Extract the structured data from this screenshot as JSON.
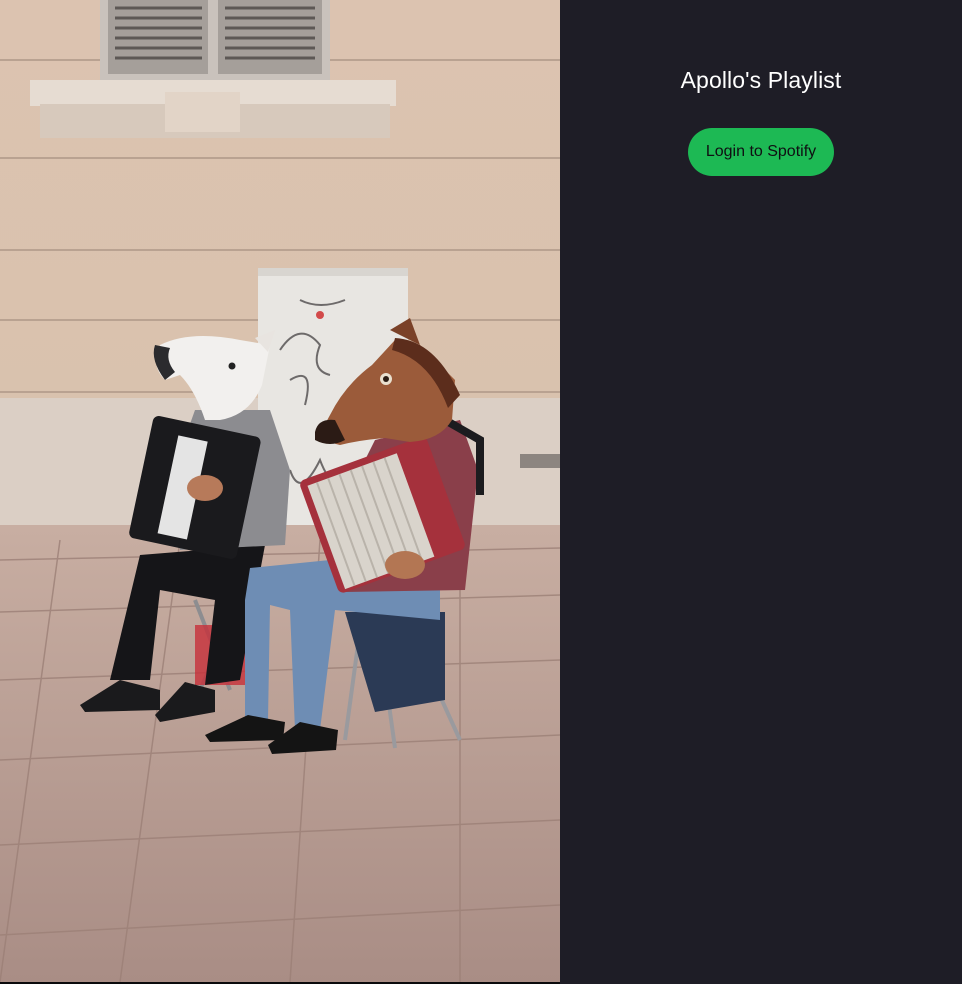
{
  "app": {
    "title": "Apollo's Playlist"
  },
  "auth": {
    "login_label": "Login to Spotify"
  },
  "hero_image": {
    "icon": "street-musicians-photo"
  },
  "colors": {
    "panel_background": "#1e1d26",
    "title_text": "#ffffff",
    "login_button": "#1db954",
    "login_button_text": "#0f0f12"
  }
}
